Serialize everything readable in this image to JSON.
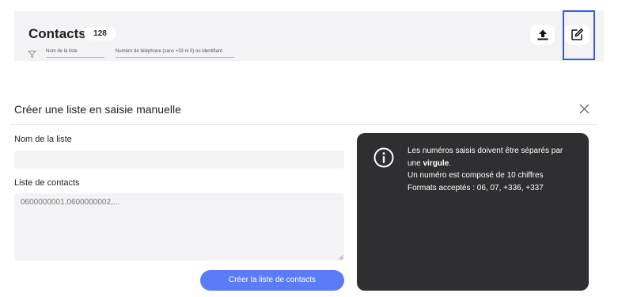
{
  "header": {
    "title": "Contacts",
    "count": "128",
    "filters": {
      "name_placeholder": "Nom de la liste",
      "phone_placeholder": "Numéro de téléphone (sans +33 ni 0) ou identifiant"
    },
    "icons": {
      "filter": "filter-icon",
      "upload": "upload-icon",
      "edit": "edit-icon"
    }
  },
  "panel": {
    "title": "Créer une liste en saisie manuelle",
    "close_icon": "close-icon",
    "name_label": "Nom de la liste",
    "name_value": "",
    "contacts_label": "Liste de contacts",
    "contacts_value": "",
    "contacts_placeholder": "0600000001,0600000002,...",
    "submit_label": "Créer la liste de contacts"
  },
  "info": {
    "icon": "info-icon",
    "line1": "Les numéros saisis doivent être séparés par",
    "line2_prefix": "une ",
    "line2_strong": "virgule",
    "line2_suffix": ".",
    "line3": "Un numéro est composé de 10 chiffres",
    "line4": "Formats acceptés : 06, 07, +336, +337"
  },
  "colors": {
    "accent": "#5b7cf7",
    "highlight": "#3b5bdb",
    "card_bg": "#2f2f31",
    "field_bg": "#f3f3f5"
  }
}
